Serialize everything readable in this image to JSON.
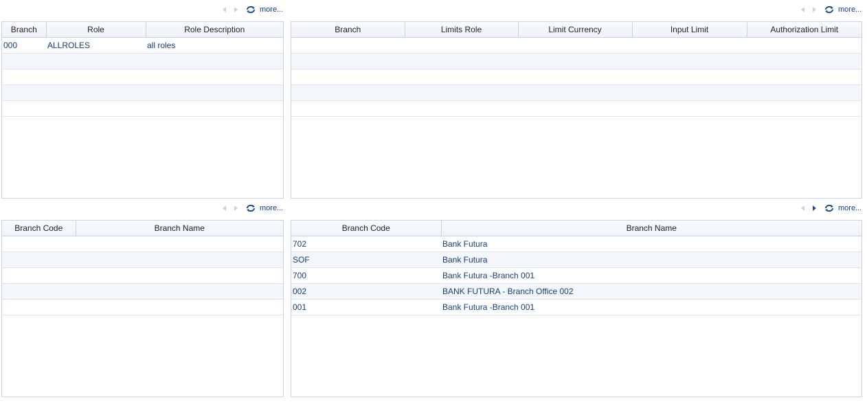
{
  "pager_more_label": "more...",
  "roles_grid": {
    "columns": [
      "Branch",
      "Role",
      "Role Description"
    ],
    "rows": [
      [
        "000",
        "ALLROLES",
        "all roles"
      ],
      [
        "",
        "",
        ""
      ],
      [
        "",
        "",
        ""
      ],
      [
        "",
        "",
        ""
      ],
      [
        "",
        "",
        ""
      ]
    ]
  },
  "limits_grid": {
    "columns": [
      "Branch",
      "Limits Role",
      "Limit Currency",
      "Input Limit",
      "Authorization Limit"
    ],
    "rows": [
      [
        "",
        "",
        "",
        "",
        ""
      ],
      [
        "",
        "",
        "",
        "",
        ""
      ],
      [
        "",
        "",
        "",
        "",
        ""
      ],
      [
        "",
        "",
        "",
        "",
        ""
      ],
      [
        "",
        "",
        "",
        "",
        ""
      ]
    ]
  },
  "branches_left_grid": {
    "columns": [
      "Branch Code",
      "Branch Name"
    ],
    "rows": [
      [
        "",
        ""
      ],
      [
        "",
        ""
      ],
      [
        "",
        ""
      ],
      [
        "",
        ""
      ],
      [
        "",
        ""
      ]
    ]
  },
  "branches_right_grid": {
    "columns": [
      "Branch Code",
      "Branch Name"
    ],
    "rows": [
      [
        "702",
        "Bank Futura"
      ],
      [
        "SOF",
        "Bank Futura"
      ],
      [
        "700",
        "Bank Futura -Branch 001"
      ],
      [
        "002",
        "BANK FUTURA - Branch Office 002"
      ],
      [
        "001",
        "Bank Futura -Branch 001"
      ]
    ]
  },
  "colors": {
    "border": "#c8d4e2",
    "alt_row": "#f3f6fb",
    "cell_text": "#173d73",
    "link": "#0a3d8f"
  }
}
